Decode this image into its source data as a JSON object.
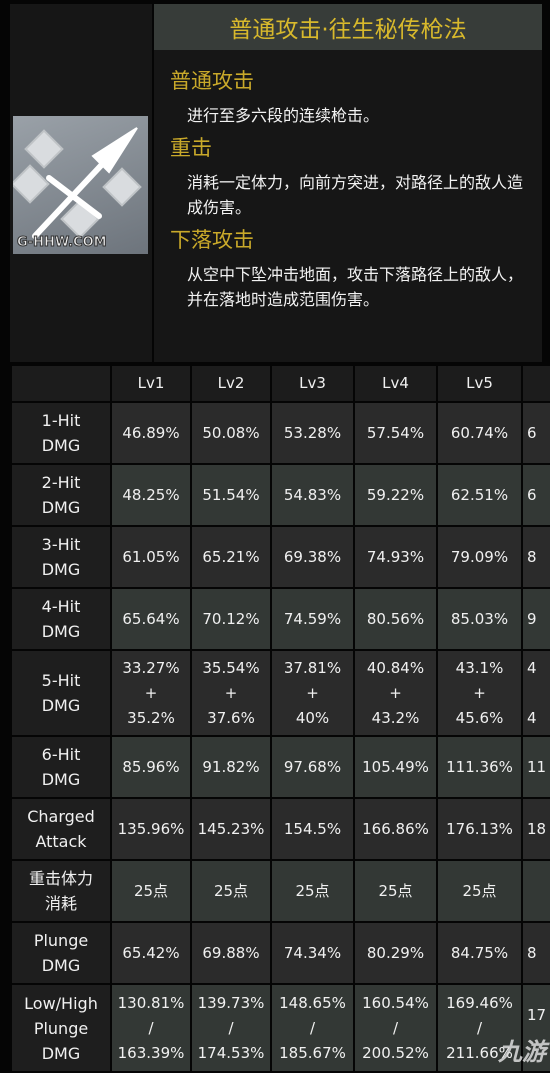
{
  "header": {
    "title": "普通攻击·往生秘传枪法"
  },
  "icon": {
    "name": "spear-icon",
    "watermark": "G-HHW.COM"
  },
  "sections": [
    {
      "title": "普通攻击",
      "text": "进行至多六段的连续枪击。"
    },
    {
      "title": "重击",
      "text": "消耗一定体力，向前方突进，对路径上的敌人造成伤害。"
    },
    {
      "title": "下落攻击",
      "text": "从空中下坠冲击地面，攻击下落路径上的敌人，并在落地时造成范围伤害。"
    }
  ],
  "table": {
    "columns": [
      "",
      "Lv1",
      "Lv2",
      "Lv3",
      "Lv4",
      "Lv5",
      ""
    ],
    "rows": [
      {
        "label": "1-Hit\nDMG",
        "values": [
          "46.89%",
          "50.08%",
          "53.28%",
          "57.54%",
          "60.74%",
          "6"
        ]
      },
      {
        "label": "2-Hit\nDMG",
        "values": [
          "48.25%",
          "51.54%",
          "54.83%",
          "59.22%",
          "62.51%",
          "6"
        ]
      },
      {
        "label": "3-Hit\nDMG",
        "values": [
          "61.05%",
          "65.21%",
          "69.38%",
          "74.93%",
          "79.09%",
          "8"
        ]
      },
      {
        "label": "4-Hit\nDMG",
        "values": [
          "65.64%",
          "70.12%",
          "74.59%",
          "80.56%",
          "85.03%",
          "9"
        ]
      },
      {
        "label": "5-Hit\nDMG",
        "values": [
          "33.27%\n+\n35.2%",
          "35.54%\n+\n37.6%",
          "37.81%\n+\n40%",
          "40.84%\n+\n43.2%",
          "43.1%\n+\n45.6%",
          "4\n\n4"
        ]
      },
      {
        "label": "6-Hit\nDMG",
        "values": [
          "85.96%",
          "91.82%",
          "97.68%",
          "105.49%",
          "111.36%",
          "11"
        ]
      },
      {
        "label": "Charged\nAttack",
        "values": [
          "135.96%",
          "145.23%",
          "154.5%",
          "166.86%",
          "176.13%",
          "18"
        ]
      },
      {
        "label": "重击体力\n消耗",
        "values": [
          "25点",
          "25点",
          "25点",
          "25点",
          "25点",
          ""
        ]
      },
      {
        "label": "Plunge\nDMG",
        "values": [
          "65.42%",
          "69.88%",
          "74.34%",
          "80.29%",
          "84.75%",
          "8"
        ]
      },
      {
        "label": "Low/High\nPlunge\nDMG",
        "values": [
          "130.81%\n/\n163.39%",
          "139.73%\n/\n174.53%",
          "148.65%\n/\n185.67%",
          "160.54%\n/\n200.52%",
          "169.46%\n/\n211.66%",
          "17\n\n"
        ]
      }
    ]
  },
  "watermark_logo": "九游"
}
